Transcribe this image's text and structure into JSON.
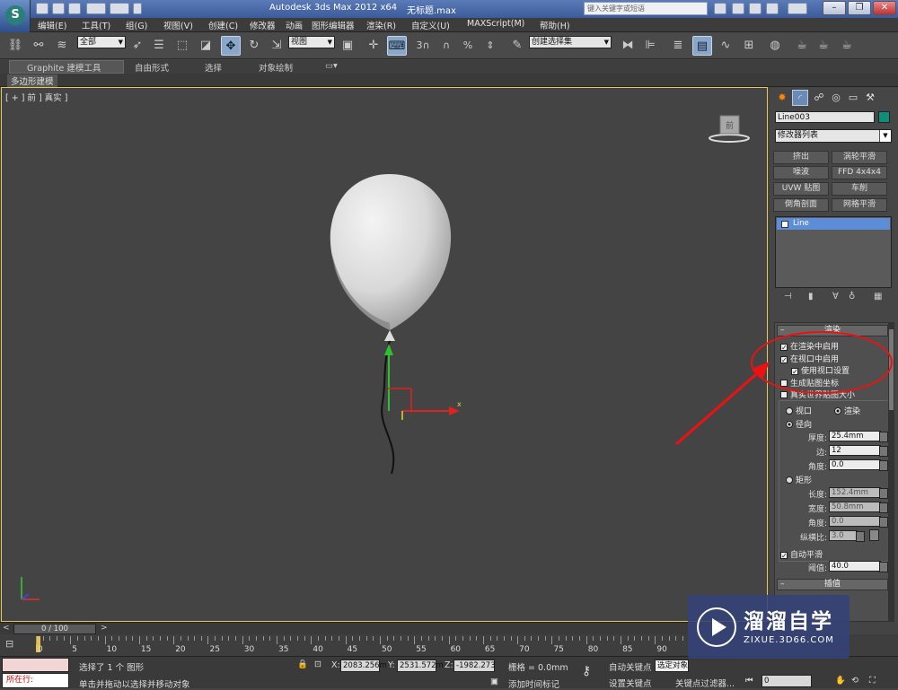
{
  "window": {
    "title": "Autodesk 3ds Max  2012 x64",
    "file": "无标题.max",
    "search_placeholder": "键入关键字或短语"
  },
  "menu": [
    "编辑(E)",
    "工具(T)",
    "组(G)",
    "视图(V)",
    "创建(C)",
    "修改器",
    "动画",
    "图形编辑器",
    "渲染(R)",
    "自定义(U)",
    "MAXScript(M)",
    "帮助(H)"
  ],
  "toolbar": {
    "selection_filter": "全部",
    "ref_coord": "视图",
    "angle_snap": "3",
    "percent_snap": "%",
    "spinner_snap": "%",
    "named_selection": "创建选择集"
  },
  "ribbon": {
    "tabs": [
      "Graphite 建模工具",
      "自由形式",
      "选择",
      "对象绘制"
    ],
    "sub": "多边形建模"
  },
  "viewport": {
    "label": "[ + ] 前 ] 真实 ]",
    "viewcube_face": "前",
    "gizmo_x_label": "x"
  },
  "panel": {
    "object_name": "Line003",
    "object_color": "#0f8d76",
    "modifier_list": "修改器列表",
    "modifier_buttons": [
      "挤出",
      "涡轮平滑",
      "噪波",
      "FFD 4x4x4",
      "UVW 贴图",
      "车削",
      "倒角剖面",
      "网格平滑"
    ],
    "stack_item": "Line",
    "rendering": {
      "title": "渲染",
      "enable_in_renderer": "在渲染中启用",
      "enable_in_viewport": "在视口中启用",
      "use_viewport_settings": "使用视口设置",
      "gen_mapping": "生成贴图坐标",
      "real_world_map": "真实世界贴图大小",
      "viewport_radio": "视口",
      "render_radio": "渲染",
      "radial": "径向",
      "thickness_label": "厚度:",
      "thickness": "25.4mm",
      "sides_label": "边:",
      "sides": "12",
      "angle_label": "角度:",
      "angle": "0.0",
      "rectangular": "矩形",
      "length_label": "长度:",
      "length": "152.4mm",
      "width_label": "宽度:",
      "width": "50.8mm",
      "angle2_label": "角度:",
      "angle2": "0.0",
      "aspect_label": "纵横比:",
      "aspect": "3.0",
      "auto_smooth": "自动平滑",
      "threshold_label": "阈值:",
      "threshold": "40.0"
    },
    "interpolation_title": "插值"
  },
  "timeline": {
    "slider": "0 / 100",
    "ticks": [
      "0",
      "5",
      "10",
      "15",
      "20",
      "25",
      "30",
      "35",
      "40",
      "45",
      "50",
      "55",
      "60",
      "65",
      "70",
      "75",
      "80",
      "85",
      "90"
    ]
  },
  "status": {
    "running": "所在行:",
    "message1": "选择了 1 个 图形",
    "message2": "单击并拖动以选择并移动对象",
    "add_time_tag": "添加时间标记",
    "x_label": "X:",
    "x": "2083.256m",
    "y_label": "Y:",
    "y": "2531.572m",
    "z_label": "Z:",
    "z": "-1982.273",
    "grid": "栅格 = 0.0mm",
    "auto_key": "自动关键点",
    "set_key": "设置关键点",
    "selected": "选定对象",
    "key_filters": "关键点过滤器...",
    "frame": "0"
  },
  "watermark": {
    "brand": "溜溜自学",
    "url": "ZIXUE.3D66.COM"
  }
}
